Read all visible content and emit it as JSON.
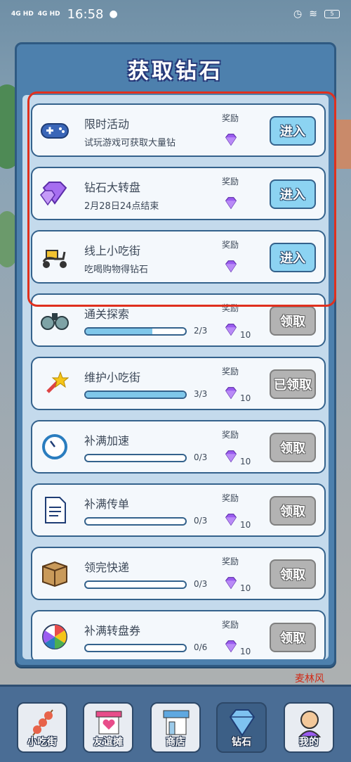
{
  "status_bar": {
    "signal1": "4G HD",
    "signal2": "4G HD",
    "time": "16:58",
    "battery": "5"
  },
  "panel": {
    "title": "获取钻石"
  },
  "reward_label": "奖励",
  "tasks": [
    {
      "name": "限时活动",
      "desc": "试玩游戏可获取大量钻",
      "button": "进入",
      "icon": "gamepad-icon"
    },
    {
      "name": "钻石大转盘",
      "desc": "2月28日24点结束",
      "button": "进入",
      "icon": "diamond-pile-icon"
    },
    {
      "name": "线上小吃街",
      "desc": "吃喝购物得钻石",
      "button": "进入",
      "icon": "scooter-icon"
    },
    {
      "name": "通关探索",
      "progress_text": "2/3",
      "progress": 0.667,
      "amount": "10",
      "button": "领取",
      "icon": "binoculars-icon"
    },
    {
      "name": "维护小吃街",
      "progress_text": "3/3",
      "progress": 1.0,
      "amount": "10",
      "button": "已领取",
      "icon": "magic-wand-icon"
    },
    {
      "name": "补满加速",
      "progress_text": "0/3",
      "progress": 0,
      "amount": "10",
      "button": "领取",
      "icon": "clock-icon"
    },
    {
      "name": "补满传单",
      "progress_text": "0/3",
      "progress": 0,
      "amount": "10",
      "button": "领取",
      "icon": "flyer-icon"
    },
    {
      "name": "领完快递",
      "progress_text": "0/3",
      "progress": 0,
      "amount": "10",
      "button": "领取",
      "icon": "package-icon"
    },
    {
      "name": "补满转盘券",
      "progress_text": "0/6",
      "progress": 0,
      "amount": "10",
      "button": "领取",
      "icon": "wheel-icon"
    }
  ],
  "watermark": "麦林风",
  "nav": [
    {
      "label": "小吃街",
      "icon": "skewer-icon",
      "active": false
    },
    {
      "label": "友谊摊",
      "icon": "heart-stall-icon",
      "active": false
    },
    {
      "label": "商店",
      "icon": "shop-icon",
      "active": false
    },
    {
      "label": "钻石",
      "icon": "diamond-icon",
      "active": true
    },
    {
      "label": "我的",
      "icon": "avatar-icon",
      "active": false
    }
  ],
  "colors": {
    "panel": "#4d80ad",
    "enter_button": "#8cd3f2",
    "claim_button": "#b3b3b3",
    "diamond": "#9b5cf0",
    "highlight": "#e0301e"
  }
}
